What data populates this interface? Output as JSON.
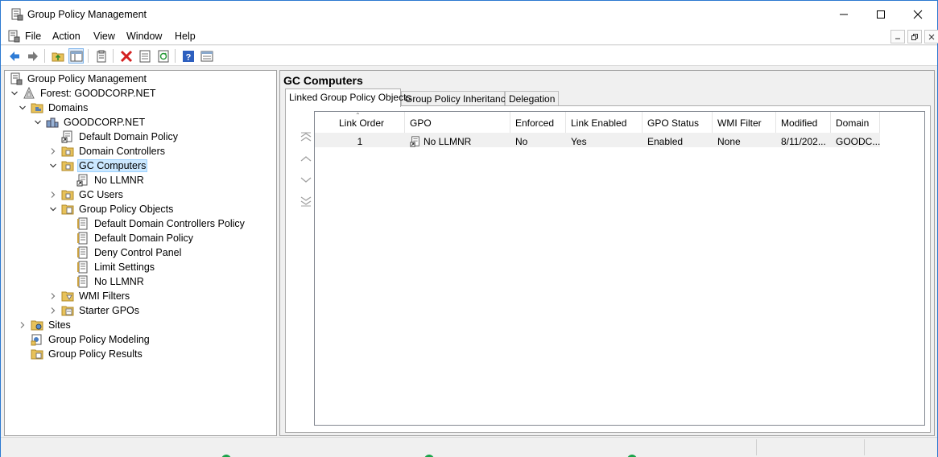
{
  "window": {
    "title": "Group Policy Management"
  },
  "menu": [
    {
      "label": "File",
      "name": "menu-file"
    },
    {
      "label": "Action",
      "name": "menu-action"
    },
    {
      "label": "View",
      "name": "menu-view"
    },
    {
      "label": "Window",
      "name": "menu-window"
    },
    {
      "label": "Help",
      "name": "menu-help"
    }
  ],
  "toolbar": [
    {
      "name": "back-icon"
    },
    {
      "name": "forward-icon"
    },
    {
      "name": "up-folder-icon"
    },
    {
      "name": "show-hide-tree-icon"
    },
    {
      "name": "properties-icon"
    },
    {
      "name": "delete-icon"
    },
    {
      "name": "export-list-icon"
    },
    {
      "name": "refresh-icon"
    },
    {
      "name": "help-icon"
    },
    {
      "name": "console-view-icon"
    }
  ],
  "tree": [
    {
      "label": "Group Policy Management",
      "level": 0,
      "expander": "none",
      "icon": "gpm-icon"
    },
    {
      "label": "Forest: GOODCORP.NET",
      "level": 0,
      "expander": "open",
      "icon": "forest-icon"
    },
    {
      "label": "Domains",
      "level": 1,
      "expander": "open",
      "icon": "domains-folder-icon"
    },
    {
      "label": "GOODCORP.NET",
      "level": 2,
      "expander": "open",
      "icon": "domain-icon"
    },
    {
      "label": "Default Domain Policy",
      "level": 3,
      "expander": "none",
      "icon": "gpo-link-icon"
    },
    {
      "label": "Domain Controllers",
      "level": 3,
      "expander": "closed",
      "icon": "ou-folder-icon"
    },
    {
      "label": "GC Computers",
      "level": 3,
      "expander": "open",
      "icon": "ou-folder-icon",
      "selected": true
    },
    {
      "label": "No LLMNR",
      "level": 4,
      "expander": "none",
      "icon": "gpo-link-icon"
    },
    {
      "label": "GC Users",
      "level": 3,
      "expander": "closed",
      "icon": "ou-folder-icon"
    },
    {
      "label": "Group Policy Objects",
      "level": 3,
      "expander": "open",
      "icon": "gpo-folder-icon"
    },
    {
      "label": "Default Domain Controllers Policy",
      "level": 4,
      "expander": "none",
      "icon": "gpo-icon"
    },
    {
      "label": "Default Domain Policy",
      "level": 4,
      "expander": "none",
      "icon": "gpo-icon"
    },
    {
      "label": "Deny Control Panel",
      "level": 4,
      "expander": "none",
      "icon": "gpo-icon"
    },
    {
      "label": "Limit Settings",
      "level": 4,
      "expander": "none",
      "icon": "gpo-icon"
    },
    {
      "label": "No LLMNR",
      "level": 4,
      "expander": "none",
      "icon": "gpo-icon"
    },
    {
      "label": "WMI Filters",
      "level": 3,
      "expander": "closed",
      "icon": "wmi-folder-icon"
    },
    {
      "label": "Starter GPOs",
      "level": 3,
      "expander": "closed",
      "icon": "starter-folder-icon"
    },
    {
      "label": "Sites",
      "level": 1,
      "expander": "closed",
      "icon": "sites-folder-icon"
    },
    {
      "label": "Group Policy Modeling",
      "level": 1,
      "expander": "none",
      "icon": "modeling-icon"
    },
    {
      "label": "Group Policy Results",
      "level": 1,
      "expander": "none",
      "icon": "results-icon"
    }
  ],
  "main": {
    "title": "GC Computers",
    "tabs": [
      {
        "label": "Linked Group Policy Objects",
        "active": true
      },
      {
        "label": "Group Policy Inheritance",
        "active": false
      },
      {
        "label": "Delegation",
        "active": false
      }
    ],
    "columns": [
      "Link Order",
      "GPO",
      "Enforced",
      "Link Enabled",
      "GPO Status",
      "WMI Filter",
      "Modified",
      "Domain"
    ],
    "rows": [
      [
        "1",
        "No LLMNR",
        "No",
        "Yes",
        "Enabled",
        "None",
        "8/11/202...",
        "GOODC..."
      ]
    ]
  },
  "colors": {
    "selection": "#cce8ff",
    "selection_border": "#99d1ff",
    "accent": "#2b79d0"
  }
}
